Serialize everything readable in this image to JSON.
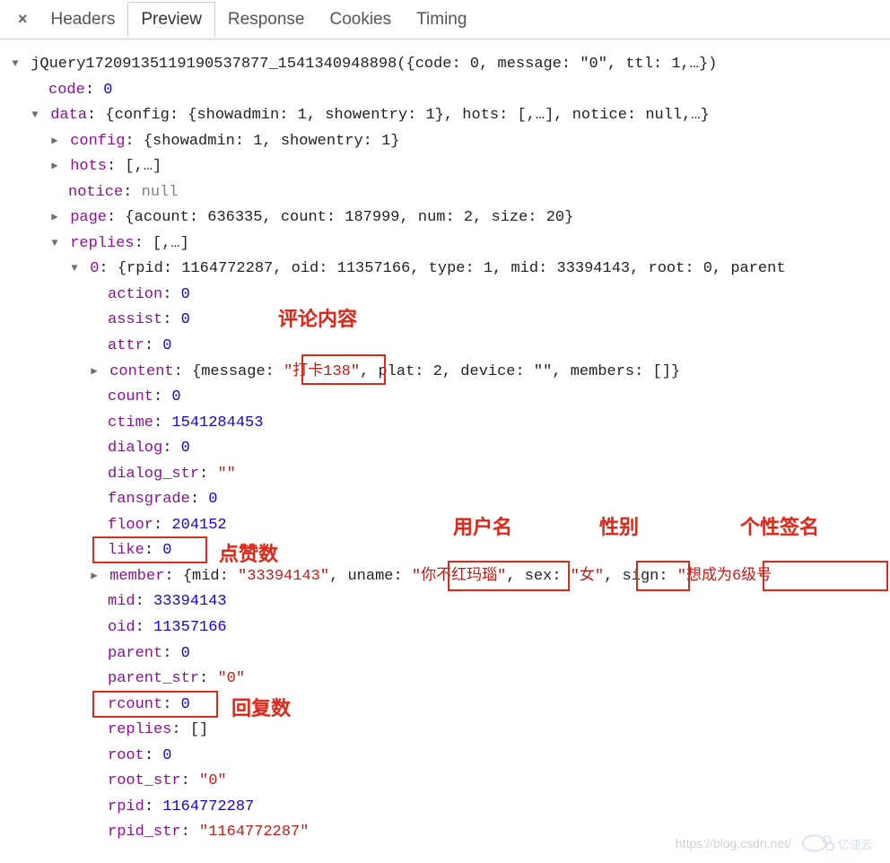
{
  "tabs": {
    "headers": "Headers",
    "preview": "Preview",
    "response": "Response",
    "cookies": "Cookies",
    "timing": "Timing"
  },
  "root": {
    "callback": "jQuery17209135119190537877_1541340948898",
    "summary_code": "code: 0",
    "summary_message": "message: \"0\"",
    "summary_ttl": "ttl: 1,…"
  },
  "fields": {
    "code_k": "code",
    "code_v": "0",
    "data_k": "data",
    "data_preview": "{config: {showadmin: 1, showentry: 1}, hots: [,…], notice: null,…}",
    "config_k": "config",
    "config_preview": "{showadmin: 1, showentry: 1}",
    "hots_k": "hots",
    "hots_preview": "[,…]",
    "notice_k": "notice",
    "notice_v": "null",
    "page_k": "page",
    "page_preview": "{acount: 636335, count: 187999, num: 2, size: 20}",
    "replies_k": "replies",
    "replies_preview": "[,…]",
    "reply0_k": "0",
    "reply0_preview": "{rpid: 1164772287, oid: 11357166, type: 1, mid: 33394143, root: 0, parent",
    "action_k": "action",
    "action_v": "0",
    "assist_k": "assist",
    "assist_v": "0",
    "attr_k": "attr",
    "attr_v": "0",
    "content_k": "content",
    "content_pre_open": "{message: ",
    "content_msg": "\"打卡138\"",
    "content_pre_rest": ", plat: 2, device: \"\", members: []}",
    "count_k": "count",
    "count_v": "0",
    "ctime_k": "ctime",
    "ctime_v": "1541284453",
    "dialog_k": "dialog",
    "dialog_v": "0",
    "dialog_str_k": "dialog_str",
    "dialog_str_v": "\"\"",
    "fansgrade_k": "fansgrade",
    "fansgrade_v": "0",
    "floor_k": "floor",
    "floor_v": "204152",
    "like_k": "like",
    "like_v": "0",
    "member_k": "member",
    "member_pre_mid": "{mid: ",
    "member_mid": "\"33394143\"",
    "member_pre_uname": ", uname: ",
    "member_uname": "\"你不红玛瑙\"",
    "member_pre_sex": ", sex: ",
    "member_sex": "\"女\"",
    "member_pre_sign": ", sign: ",
    "member_sign": "\"想成为6级号",
    "mid_k": "mid",
    "mid_v": "33394143",
    "oid_k": "oid",
    "oid_v": "11357166",
    "parent_k": "parent",
    "parent_v": "0",
    "parent_str_k": "parent_str",
    "parent_str_v": "\"0\"",
    "rcount_k": "rcount",
    "rcount_v": "0",
    "replies2_k": "replies",
    "replies2_v": "[]",
    "root_k": "root",
    "root_v": "0",
    "root_str_k": "root_str",
    "root_str_v": "\"0\"",
    "rpid_k": "rpid",
    "rpid_v": "1164772287",
    "rpid_str_k": "rpid_str",
    "rpid_str_v": "\"1164772287\""
  },
  "annotations": {
    "comment_content": "评论内容",
    "likes": "点赞数",
    "username": "用户名",
    "gender": "性别",
    "signature": "个性签名",
    "reply_count": "回复数"
  },
  "watermark": "https://blog.csdn.net/",
  "logo_text": "亿速云"
}
